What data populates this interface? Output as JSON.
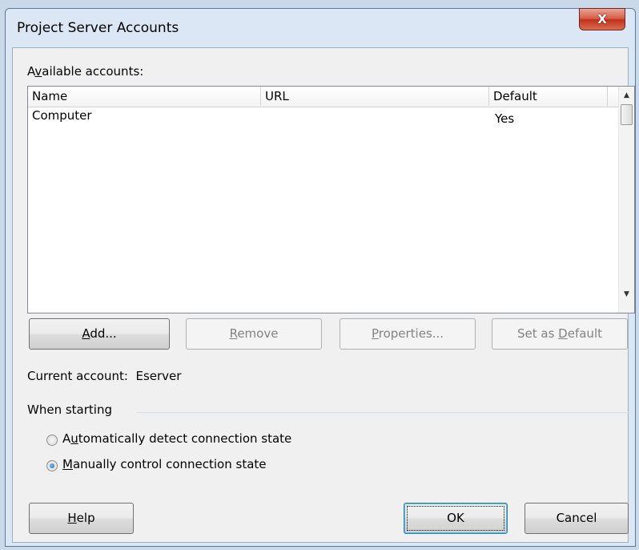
{
  "window": {
    "title": "Project Server Accounts",
    "close_label": "X"
  },
  "available_label": {
    "pre": "A",
    "key": "v",
    "post": "ailable accounts:"
  },
  "list": {
    "columns": [
      "Name",
      "URL",
      "Default"
    ],
    "rows": [
      {
        "name": "Computer",
        "url": "",
        "default": "Yes"
      }
    ],
    "scroll_up": "▲",
    "scroll_down": "▼"
  },
  "buttons": {
    "add": {
      "key": "A",
      "rest": "dd..."
    },
    "remove": {
      "pre": "",
      "key": "R",
      "post": "emove"
    },
    "properties": {
      "pre": "",
      "key": "P",
      "post": "roperties..."
    },
    "set_default": {
      "pre": "Set as ",
      "key": "D",
      "post": "efault"
    },
    "help": {
      "pre": "",
      "key": "H",
      "post": "elp"
    },
    "ok": "OK",
    "cancel": "Cancel"
  },
  "current_account": {
    "label": "Current account:",
    "value": "Eserver"
  },
  "when_starting": {
    "title": "When starting",
    "options": [
      {
        "pre": "A",
        "key": "u",
        "post": "tomatically detect connection state",
        "checked": false
      },
      {
        "pre": "",
        "key": "M",
        "post": "anually control connection state",
        "checked": true
      }
    ]
  }
}
